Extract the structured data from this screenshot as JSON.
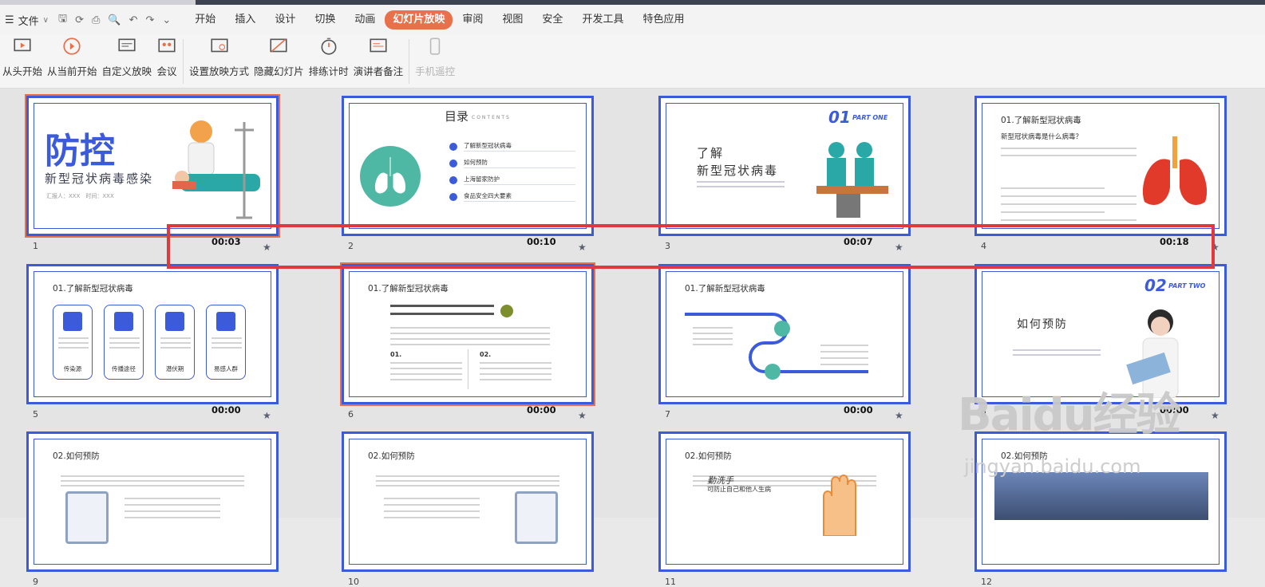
{
  "menu": {
    "file_label": "文件",
    "tabs": [
      "开始",
      "插入",
      "设计",
      "切换",
      "动画",
      "幻灯片放映",
      "审阅",
      "视图",
      "安全",
      "开发工具",
      "特色应用"
    ],
    "active_tab": "幻灯片放映"
  },
  "ribbon": {
    "buttons": [
      "从头开始",
      "从当前开始",
      "自定义放映",
      "会议",
      "设置放映方式",
      "隐藏幻灯片",
      "排练计时",
      "演讲者备注",
      "手机遥控"
    ]
  },
  "slides": [
    {
      "num": "1",
      "time": "00:03",
      "title": "防控",
      "subtitle": "新型冠状病毒感染",
      "footer": "汇报人：XXX　时间：XXX"
    },
    {
      "num": "2",
      "time": "00:10",
      "title": "目录",
      "title_en": "CONTENTS",
      "items": [
        "了解新型冠状病毒",
        "如何预防",
        "上海留家防护",
        "食品安全四大要素"
      ]
    },
    {
      "num": "3",
      "time": "00:07",
      "part": "01",
      "part_label": "PART ONE",
      "title": "了解",
      "subtitle": "新型冠状病毒"
    },
    {
      "num": "4",
      "time": "00:18",
      "heading": "01.了解新型冠状病毒",
      "question": "新型冠状病毒是什么病毒？"
    },
    {
      "num": "5",
      "time": "00:00",
      "heading": "01.了解新型冠状病毒",
      "cards": [
        "传染源",
        "传播途径",
        "潜伏期",
        "易感人群"
      ]
    },
    {
      "num": "6",
      "time": "00:00",
      "heading": "01.了解新型冠状病毒",
      "col1": "01.",
      "col2": "02."
    },
    {
      "num": "7",
      "time": "00:00",
      "heading": "01.了解新型冠状病毒"
    },
    {
      "num": "8",
      "time": "00:00",
      "part": "02",
      "part_label": "PART TWO",
      "title": "如何预防"
    },
    {
      "num": "9",
      "heading": "02.如何预防"
    },
    {
      "num": "10",
      "heading": "02.如何预防"
    },
    {
      "num": "11",
      "heading": "02.如何预防",
      "sub": "勤洗手",
      "sub2": "可防止自己和他人生病"
    },
    {
      "num": "12",
      "heading": "02.如何预防"
    }
  ],
  "watermark": {
    "brand": "Baidu经验",
    "url": "jingyan.baidu.com"
  },
  "colors": {
    "accent": "#e8704b",
    "slide_border": "#3b5bdb",
    "highlight": "#e0383f"
  }
}
